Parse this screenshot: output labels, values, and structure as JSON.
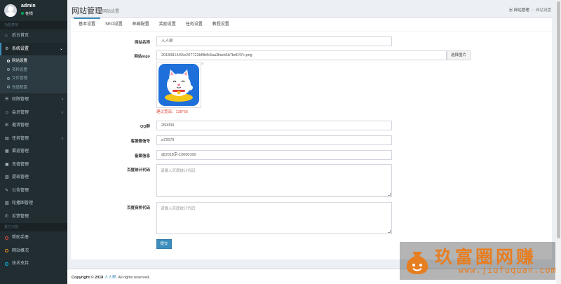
{
  "sidebar": {
    "user": {
      "name": "admin",
      "status": "在线"
    },
    "section_main": "功能菜单",
    "items_top": [
      {
        "label": "后台首页",
        "icon": "home-icon",
        "glyph": "⌂"
      }
    ],
    "system": {
      "label": "系统设置",
      "icon": "gear-icon",
      "glyph": "⚙"
    },
    "system_sub": [
      {
        "label": "网站设置"
      },
      {
        "label": "资料设置"
      },
      {
        "label": "文件管理"
      },
      {
        "label": "充值配置"
      }
    ],
    "items": [
      {
        "label": "权限管理",
        "glyph": "☰",
        "chev": "‹"
      },
      {
        "label": "会员管理",
        "glyph": "☺",
        "chev": "‹"
      },
      {
        "label": "邀请管理",
        "glyph": "✉",
        "chev": ""
      },
      {
        "label": "任务管理",
        "glyph": "▤",
        "chev": "‹"
      },
      {
        "label": "渠道管理",
        "glyph": "▦",
        "chev": ""
      },
      {
        "label": "充值管理",
        "glyph": "▣",
        "chev": ""
      },
      {
        "label": "提现管理",
        "glyph": "▥",
        "chev": ""
      },
      {
        "label": "公告管理",
        "glyph": "✎",
        "chev": ""
      },
      {
        "label": "轮播图管理",
        "glyph": "▧",
        "chev": ""
      },
      {
        "label": "反馈管理",
        "glyph": "✆",
        "chev": ""
      }
    ],
    "section_help": "其它功能",
    "help_items": [
      {
        "label": "帮助手册"
      },
      {
        "label": "网站概况"
      },
      {
        "label": "技术支持"
      }
    ]
  },
  "header": {
    "title": "网站管理",
    "subtitle": "网站设置",
    "breadcrumb_home": "网站管理",
    "breadcrumb_current": "网站设置"
  },
  "tabs": [
    "基本设置",
    "SEO设置",
    "邮箱配置",
    "奖励设置",
    "任务设置",
    "教程设置"
  ],
  "form": {
    "site_name_label": "网站名称",
    "site_name_value": "人人帮",
    "logo_label": "网站logo",
    "logo_value": "20180814/65e207722bf9bfb3aa3fabb5b7bd047c.png",
    "logo_button": "选择图片",
    "logo_hint": "建议宽高：138*56",
    "close_glyph": "×",
    "qq_label": "QQ群",
    "qq_value": "250000",
    "wechat_label": "客服微信号",
    "wechat_value": "a72670",
    "icp_label": "备案信息",
    "icp_value": "@2018京-10000100",
    "baidu_stat_label": "百度统计代码",
    "baidu_stat_placeholder": "请输入百度统计代码",
    "baidu_bridge_label": "百度商桥代码",
    "baidu_bridge_placeholder": "请输入百度统计代码",
    "submit_label": "提交"
  },
  "footer": {
    "prefix": "Copyright © 2018",
    "brand": "人人帮",
    "suffix": ". All rights reserved."
  },
  "watermark": {
    "title": "玖富圈网赚",
    "url": "www.jiufuquan.com"
  },
  "colors": {
    "sidebar_bg": "#222d32",
    "accent": "#3c8dbc",
    "danger": "#dd4b39",
    "watermark": "#e67e22"
  }
}
